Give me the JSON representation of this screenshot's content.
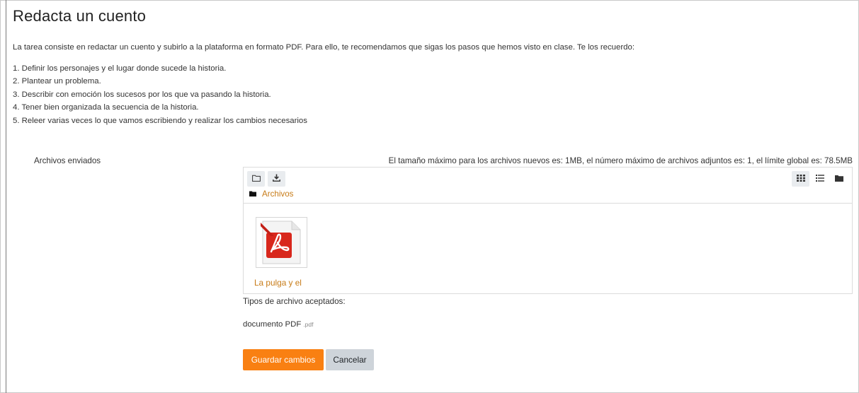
{
  "page": {
    "title": "Redacta un cuento"
  },
  "intro": "La tarea consiste en redactar un cuento y subirlo a la plataforma en formato PDF. Para ello, te recomendamos que sigas los pasos que hemos visto en clase. Te los recuerdo:",
  "steps": [
    "1. Definir los personajes y el lugar donde sucede la historia.",
    "2. Plantear un problema.",
    "3. Describir con emoción los sucesos por los que va pasando la historia.",
    "4. Tener bien organizada la secuencia de la historia.",
    "5. Releer varias veces lo que vamos escribiendo y realizar los cambios necesarios"
  ],
  "submission": {
    "label": "Archivos enviados",
    "limits": "El tamaño máximo para los archivos nuevos es: 1MB, el número máximo de archivos adjuntos es: 1, el límite global es: 78.5MB"
  },
  "filemanager": {
    "toolbar_left_icons": [
      "folder-outline-icon",
      "download-icon"
    ],
    "toolbar_right_icons": [
      "grid-view-icon",
      "list-view-icon",
      "folder-view-icon"
    ],
    "path_icon": "folder-icon",
    "path_label": "Archivos",
    "files": [
      {
        "name": "La pulga y el",
        "icon": "pdf-file-icon"
      }
    ]
  },
  "accepted": {
    "label": "Tipos de archivo aceptados:",
    "type_name": "documento PDF",
    "type_ext": ".pdf"
  },
  "buttons": {
    "save": "Guardar cambios",
    "cancel": "Cancelar"
  },
  "colors": {
    "accent": "#f98012",
    "link": "#c77b17",
    "secondary_button": "#ced4da",
    "pdf_red": "#d8271c"
  }
}
